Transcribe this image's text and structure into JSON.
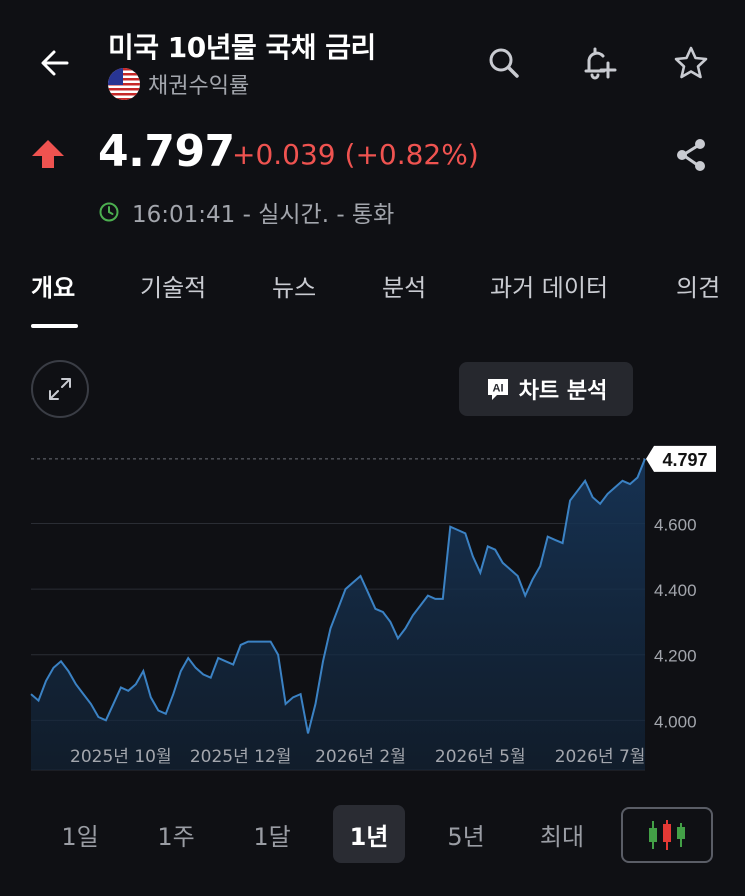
{
  "header": {
    "title": "미국 10년물 국채 금리",
    "subtitle": "채권수익률"
  },
  "quote": {
    "price": "4.797",
    "change": "+0.039 (+0.82%)",
    "direction": "up",
    "status": "16:01:41 - 실시간. - 통화"
  },
  "tabs": [
    {
      "label": "개요",
      "active": true
    },
    {
      "label": "기술적"
    },
    {
      "label": "뉴스"
    },
    {
      "label": "분석"
    },
    {
      "label": "과거 데이터"
    },
    {
      "label": "의견"
    }
  ],
  "ai_button": {
    "icon": "AI",
    "label": "차트 분석"
  },
  "chart_data": {
    "type": "area",
    "current_value_label": "4.797",
    "y_ticks": [
      "4.000",
      "4.200",
      "4.400",
      "4.600"
    ],
    "ylim": [
      3.94,
      4.83
    ],
    "x_tick_labels": [
      "2025년 10월",
      "2025년 12월",
      "2026년 2월",
      "2026년 5월",
      "2026년 7월"
    ],
    "x_tick_index": [
      12,
      28,
      44,
      60,
      76
    ],
    "series": [
      {
        "values": [
          4.08,
          4.06,
          4.12,
          4.16,
          4.18,
          4.15,
          4.11,
          4.08,
          4.05,
          4.01,
          4.0,
          4.05,
          4.1,
          4.09,
          4.11,
          4.15,
          4.07,
          4.03,
          4.02,
          4.08,
          4.15,
          4.19,
          4.16,
          4.14,
          4.13,
          4.19,
          4.18,
          4.17,
          4.23,
          4.24,
          4.24,
          4.24,
          4.24,
          4.2,
          4.05,
          4.07,
          4.08,
          3.96,
          4.05,
          4.18,
          4.28,
          4.34,
          4.4,
          4.42,
          4.44,
          4.39,
          4.34,
          4.33,
          4.3,
          4.25,
          4.28,
          4.32,
          4.35,
          4.38,
          4.37,
          4.37,
          4.59,
          4.58,
          4.57,
          4.5,
          4.45,
          4.53,
          4.52,
          4.48,
          4.46,
          4.44,
          4.38,
          4.43,
          4.47,
          4.56,
          4.55,
          4.54,
          4.67,
          4.7,
          4.73,
          4.68,
          4.66,
          4.69,
          4.71,
          4.73,
          4.72,
          4.74,
          4.797
        ]
      }
    ],
    "colors": {
      "line": "#3b82c4",
      "fill": "#16304d",
      "label_bg": "#ffffff"
    }
  },
  "periods": [
    {
      "label": "1일"
    },
    {
      "label": "1주"
    },
    {
      "label": "1달"
    },
    {
      "label": "1년",
      "active": true
    },
    {
      "label": "5년"
    },
    {
      "label": "최대"
    }
  ],
  "colors": {
    "up": "#ef5350",
    "background": "#0f1014",
    "muted": "#a3a6ad",
    "live": "#4caf50"
  },
  "icons": {
    "back": "arrow-left-icon",
    "search": "search-icon",
    "alert": "bell-plus-icon",
    "favorite": "star-icon",
    "share": "share-icon",
    "clock": "clock-icon",
    "expand": "expand-icon",
    "chart_type": "candlestick-icon"
  }
}
